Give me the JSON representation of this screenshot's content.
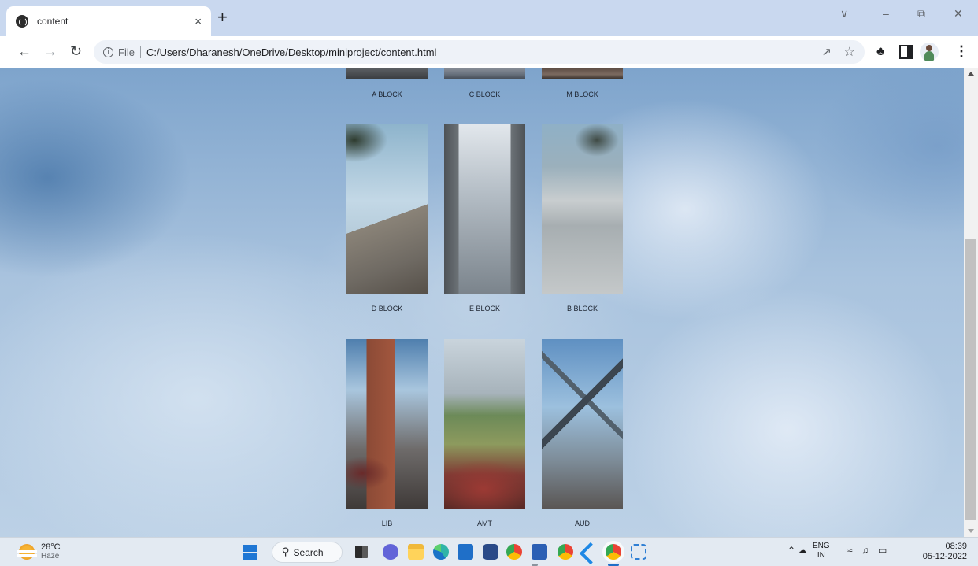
{
  "browser": {
    "tab_title": "content",
    "tab_close": "×",
    "new_tab": "+",
    "url_scheme": "File",
    "url": "C:/Users/Dharanesh/OneDrive/Desktop/miniproject/content.html",
    "window_controls": {
      "collapse": "∨",
      "minimize": "–",
      "restore": "⧉",
      "close": "✕"
    }
  },
  "gallery": {
    "rows": [
      [
        {
          "label": "A BLOCK"
        },
        {
          "label": "C BLOCK"
        },
        {
          "label": "M BLOCK"
        }
      ],
      [
        {
          "label": "D BLOCK"
        },
        {
          "label": "E BLOCK"
        },
        {
          "label": "B BLOCK"
        }
      ],
      [
        {
          "label": "LIB"
        },
        {
          "label": "AMT"
        },
        {
          "label": "AUD"
        }
      ]
    ]
  },
  "taskbar": {
    "weather": {
      "temp": "28°C",
      "condition": "Haze"
    },
    "search_label": "Search",
    "lang": {
      "line1": "ENG",
      "line2": "IN"
    },
    "clock": {
      "time": "08:39",
      "date": "05-12-2022"
    }
  },
  "icons": {
    "back": "back-arrow-icon",
    "forward": "forward-arrow-icon",
    "reload": "reload-icon",
    "info": "info-icon",
    "share": "share-icon",
    "bookmark": "star-icon",
    "extensions": "puzzle-icon",
    "side_panel": "side-panel-icon",
    "profile": "profile-avatar-icon",
    "menu": "kebab-menu-icon"
  }
}
